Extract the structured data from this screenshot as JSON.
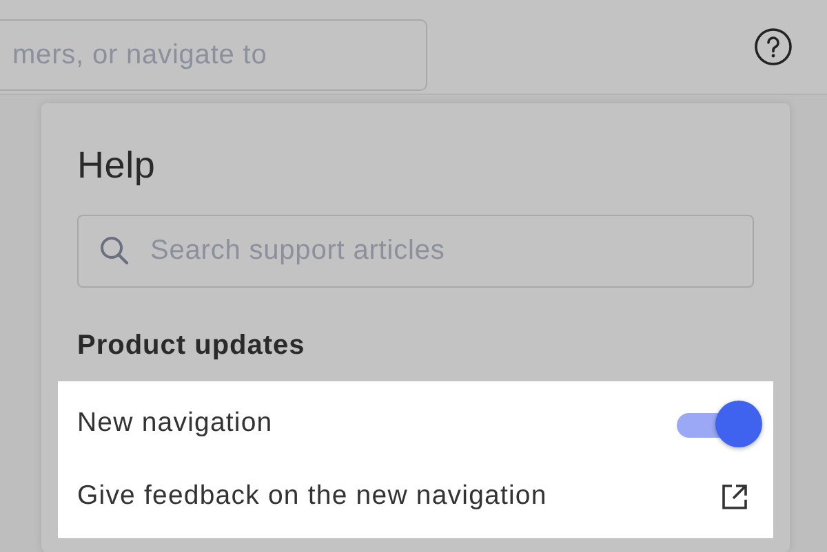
{
  "top_bar": {
    "search": {
      "placeholder": "mers, or navigate to"
    }
  },
  "help_panel": {
    "title": "Help",
    "search": {
      "placeholder": "Search support articles"
    },
    "section": "Product updates",
    "items": [
      {
        "kind": "toggle",
        "label": "New navigation",
        "on": true
      },
      {
        "kind": "link",
        "label": "Give feedback on the new navigation"
      }
    ]
  }
}
